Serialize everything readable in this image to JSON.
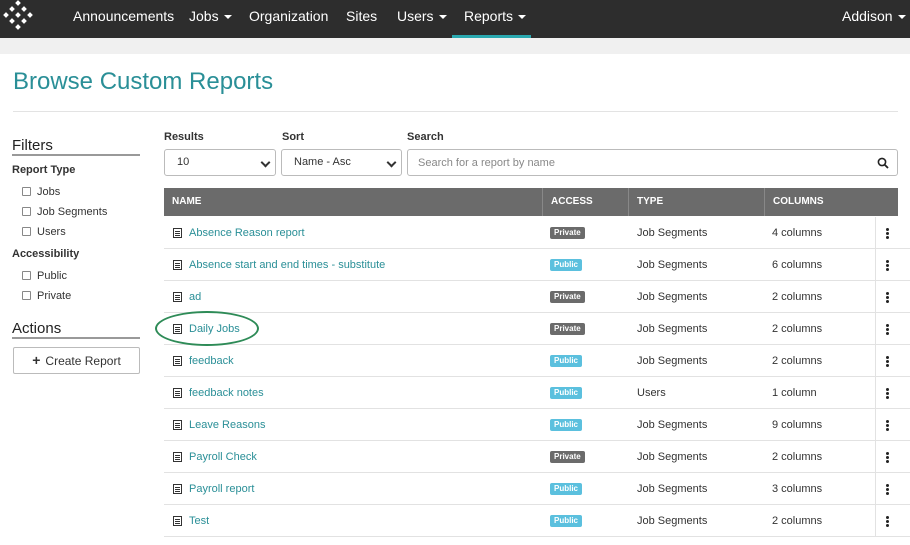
{
  "nav": {
    "items": [
      {
        "label": "Announcements",
        "dropdown": false
      },
      {
        "label": "Jobs",
        "dropdown": true
      },
      {
        "label": "Organization",
        "dropdown": false
      },
      {
        "label": "Sites",
        "dropdown": false
      },
      {
        "label": "Users",
        "dropdown": true
      },
      {
        "label": "Reports",
        "dropdown": true,
        "active": true
      }
    ],
    "user": "Addison",
    "accent": "#2aa9b0"
  },
  "page": {
    "title": "Browse Custom Reports"
  },
  "sidebar": {
    "filters_heading": "Filters",
    "report_type_label": "Report Type",
    "report_types": [
      "Jobs",
      "Job Segments",
      "Users"
    ],
    "accessibility_label": "Accessibility",
    "accessibility": [
      "Public",
      "Private"
    ],
    "actions_heading": "Actions",
    "create_button": "Create Report"
  },
  "controls": {
    "results_label": "Results",
    "results_value": "10",
    "sort_label": "Sort",
    "sort_value": "Name - Asc",
    "search_label": "Search",
    "search_placeholder": "Search for a report by name"
  },
  "table": {
    "headers": [
      "NAME",
      "ACCESS",
      "TYPE",
      "COLUMNS"
    ],
    "rows": [
      {
        "name": "Absence Reason report",
        "access": "Private",
        "type": "Job Segments",
        "columns": "4 columns"
      },
      {
        "name": "Absence start and end times - substitute",
        "access": "Public",
        "type": "Job Segments",
        "columns": "6 columns"
      },
      {
        "name": "ad",
        "access": "Private",
        "type": "Job Segments",
        "columns": "2 columns"
      },
      {
        "name": "Daily Jobs",
        "access": "Private",
        "type": "Job Segments",
        "columns": "2 columns"
      },
      {
        "name": "feedback",
        "access": "Public",
        "type": "Job Segments",
        "columns": "2 columns"
      },
      {
        "name": "feedback notes",
        "access": "Public",
        "type": "Users",
        "columns": "1 column"
      },
      {
        "name": "Leave Reasons",
        "access": "Public",
        "type": "Job Segments",
        "columns": "9 columns"
      },
      {
        "name": "Payroll Check",
        "access": "Private",
        "type": "Job Segments",
        "columns": "2 columns"
      },
      {
        "name": "Payroll report",
        "access": "Public",
        "type": "Job Segments",
        "columns": "3 columns"
      },
      {
        "name": "Test",
        "access": "Public",
        "type": "Job Segments",
        "columns": "2 columns"
      }
    ]
  },
  "colors": {
    "link": "#2a8f97",
    "private_badge": "#6b6b6b",
    "public_badge": "#5bc0de",
    "highlight": "#2e8b57"
  }
}
